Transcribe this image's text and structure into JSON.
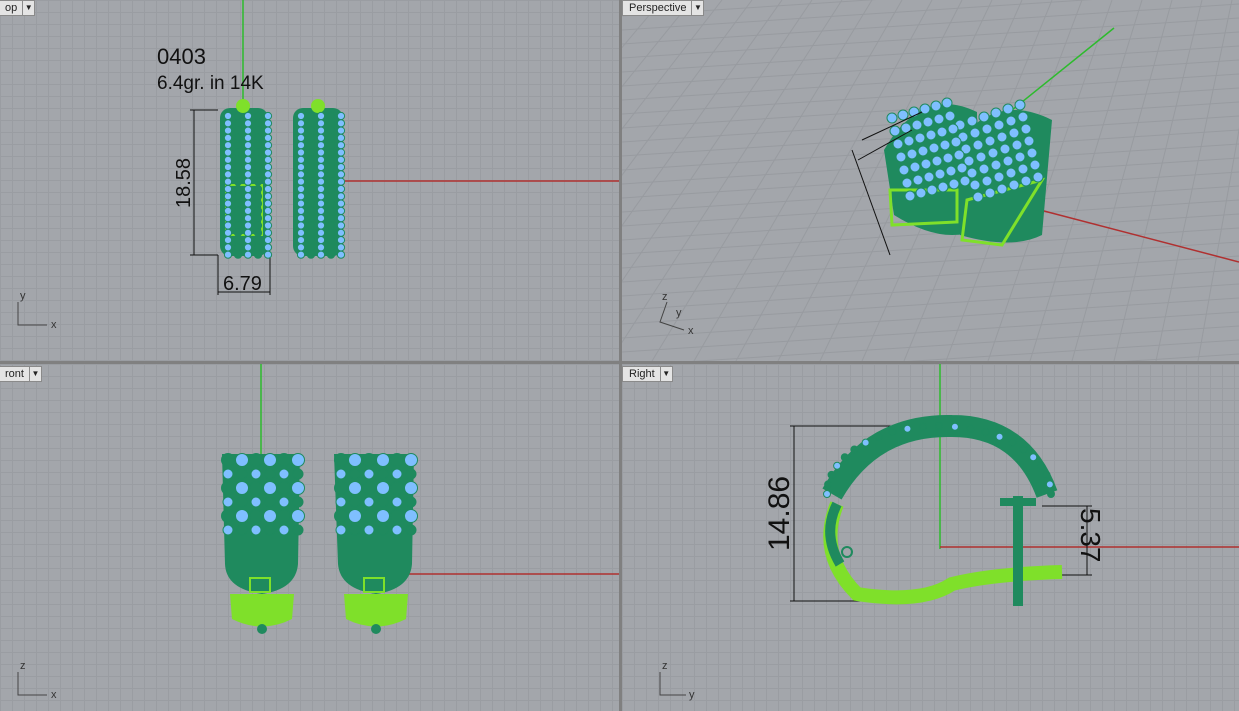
{
  "viewports": {
    "top": {
      "label": "op",
      "note_line1": "0403",
      "note_line2": "6.4gr.  in 14K",
      "dim_height": "18.58",
      "dim_width": "6.79",
      "axis_v": "y",
      "axis_h": "x"
    },
    "perspective": {
      "label": "Perspective",
      "axis_z": "z",
      "axis_y": "y",
      "axis_x": "x"
    },
    "front": {
      "label": "ront",
      "axis_v": "z",
      "axis_h": "x"
    },
    "right": {
      "label": "Right",
      "dim_height": "14.86",
      "dim_post": "5.37",
      "axis_v": "z",
      "axis_h": "y"
    }
  },
  "colors": {
    "viewport_bg": "#a3a6ab",
    "grid": "#9a9da2",
    "metal_dark": "#1f8a5e",
    "metal_light": "#7fe02a",
    "gem": "#7fbfff",
    "axis_x": "#b03030",
    "axis_y": "#2dbb2d"
  }
}
